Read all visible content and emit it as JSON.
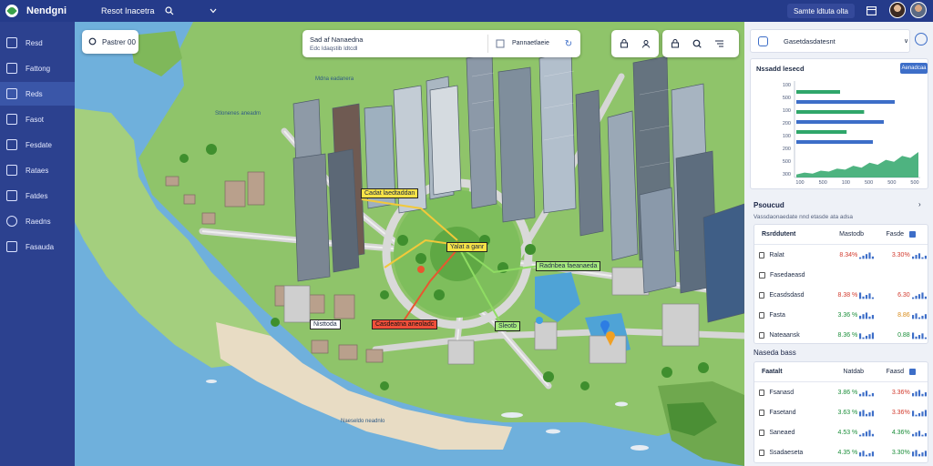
{
  "app": {
    "name": "Nendgni",
    "dataset": "Resot Inacetra"
  },
  "header": {
    "date_label": "Samte ldtuta olta"
  },
  "sidebar": {
    "items": [
      {
        "label": "Resd"
      },
      {
        "label": "Fattong"
      },
      {
        "label": "Reds"
      },
      {
        "label": "Fasot"
      },
      {
        "label": "Fesdate"
      },
      {
        "label": "Rataes"
      },
      {
        "label": "Fatdes"
      },
      {
        "label": "Raedns"
      },
      {
        "label": "Fasauda"
      }
    ],
    "active_index": 2
  },
  "map": {
    "search_placeholder": "Pastrer 00",
    "info_title": "Sad af Nanaedna",
    "info_subtitle": "Edc ldaqstib ldtcdl",
    "layer_label": "Pannaetlaeie",
    "callouts": [
      {
        "text": "Cadat laedtaddan"
      },
      {
        "text": "Yalat a ganr"
      },
      {
        "text": "Radnbea faeanaeda"
      },
      {
        "text": "Casdeatna aneoladc"
      },
      {
        "text": "Sleotb"
      },
      {
        "text": "Nisttoda"
      }
    ],
    "water_label_top": "Mdna eadanera",
    "water_label_left": "Stlonenes aneadm",
    "water_label_bottom": "Naeseldo neadnlo"
  },
  "panel": {
    "dropdown_label": "Gasetdasdatesnt",
    "chart_card": {
      "title": "Nssadd lesecd",
      "button_label": "Aenadcaa"
    },
    "section1": {
      "title": "Psoucud",
      "subtitle": "Vassdaonaedate nnd etasde ata adsa",
      "header": {
        "name": "Rsrddutent",
        "col1": "Mastodb",
        "col2": "Fasde"
      },
      "rows": [
        {
          "name": "Ralat",
          "v1": "8.34%",
          "v2": "3.30%",
          "t1": "neg",
          "t2": "neg"
        },
        {
          "name": "Fasedaeasd",
          "v1": "",
          "v2": "",
          "t1": "neg",
          "t2": "neg"
        },
        {
          "name": "Ecasdsdasd",
          "v1": "8.38 %",
          "v2": "6.30",
          "t1": "neg",
          "t2": "neg"
        },
        {
          "name": "Fasta",
          "v1": "3.36 %",
          "v2": "8.86",
          "t1": "pos",
          "t2": "amb"
        },
        {
          "name": "Nateaansk",
          "v1": "8.36 %",
          "v2": "0.88",
          "t1": "pos",
          "t2": "pos"
        }
      ]
    },
    "section2": {
      "title": "Naseda bass",
      "header": {
        "name": "Faatalt",
        "col1": "Natdab",
        "col2": "Faasd"
      },
      "rows": [
        {
          "name": "Fsanasd",
          "v1": "3.86 %",
          "v2": "3.36%",
          "t1": "pos",
          "t2": "neg"
        },
        {
          "name": "Fasetand",
          "v1": "3.63 %",
          "v2": "3.36%",
          "t1": "pos",
          "t2": "neg"
        },
        {
          "name": "Saneaed",
          "v1": "4.53 %",
          "v2": "4.36%",
          "t1": "pos",
          "t2": "pos"
        },
        {
          "name": "Ssadaeseta",
          "v1": "4.35 %",
          "v2": "3.30%",
          "t1": "pos",
          "t2": "pos"
        }
      ]
    }
  },
  "colors": {
    "sidebar": "#2c418f",
    "topbar": "#253b8a",
    "accent_blue": "#3d6ec8",
    "accent_green": "#2fa66a",
    "positive": "#1b8e3a",
    "negative": "#d23a2d"
  },
  "chart_data": {
    "type": "bar",
    "categories": [
      "100",
      "500",
      "100",
      "500",
      "500",
      "500"
    ],
    "x_tick_labels": [
      "100",
      "500",
      "100",
      "500",
      "500",
      "500"
    ],
    "y_tick_labels": [
      "100",
      "500",
      "100",
      "200",
      "100",
      "200",
      "500",
      "300"
    ],
    "series": [
      {
        "values": [
          40,
          90,
          62,
          80,
          46,
          70
        ]
      }
    ],
    "area_series": [
      3,
      5,
      4,
      7,
      6,
      9,
      8,
      12,
      10,
      15,
      13,
      18,
      16,
      22,
      20,
      26
    ],
    "orientation": "horizontal",
    "grid": false
  }
}
